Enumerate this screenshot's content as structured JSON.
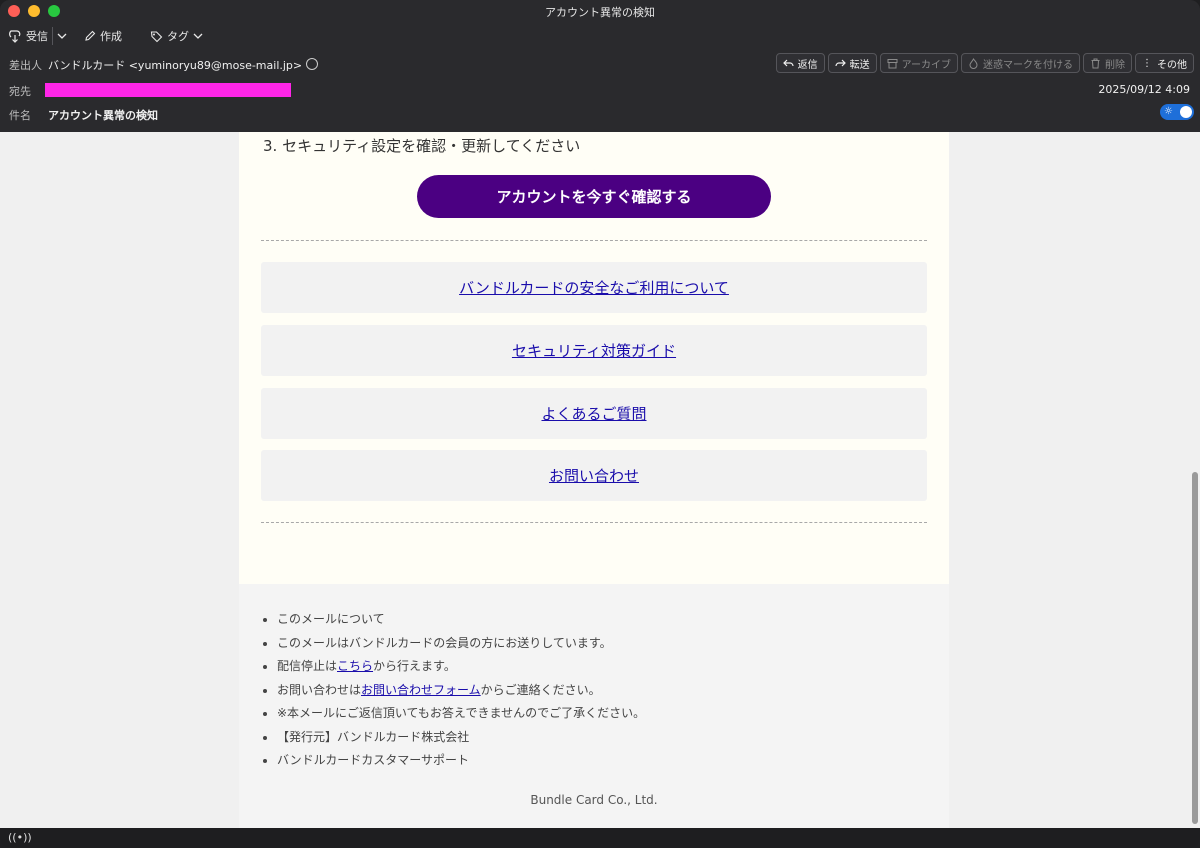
{
  "window": {
    "title": "アカウント異常の検知"
  },
  "toolbar": {
    "receive": "受信",
    "compose": "作成",
    "tag": "タグ"
  },
  "header": {
    "from_label": "差出人",
    "from_value": "バンドルカード <yuminoryu89@mose-mail.jp>",
    "to_label": "宛先",
    "subject_label": "件名",
    "subject_value": "アカウント異常の検知",
    "date": "2025/09/12 4:09"
  },
  "actions": {
    "reply": "返信",
    "forward": "転送",
    "archive": "アーカイブ",
    "junk": "迷惑マークを付ける",
    "delete": "削除",
    "more": "その他"
  },
  "email": {
    "step3": "3. セキュリティ設定を確認・更新してください",
    "cta": "アカウントを今すぐ確認する",
    "links": [
      "バンドルカードの安全なご利用について",
      "セキュリティ対策ガイド",
      "よくあるご質問",
      "お問い合わせ"
    ],
    "footer": {
      "about": "このメールについて",
      "sent_to": "このメールはバンドルカードの会員の方にお送りしています。",
      "unsub_prefix": "配信停止は",
      "unsub_link": "こちら",
      "unsub_suffix": "から行えます。",
      "contact_prefix": "お問い合わせは",
      "contact_link": "お問い合わせフォーム",
      "contact_suffix": "からご連絡ください。",
      "noreply": "※本メールにご返信頂いてもお答えできませんのでご了承ください。",
      "publisher": "【発行元】バンドルカード株式会社",
      "support": "バンドルカードカスタマーサポート",
      "copyright": "Bundle Card Co., Ltd."
    }
  },
  "colors": {
    "cta": "#4b0082",
    "redaction": "#ff25e8",
    "link": "#1a0dab",
    "toggle": "#1e6fd9"
  }
}
